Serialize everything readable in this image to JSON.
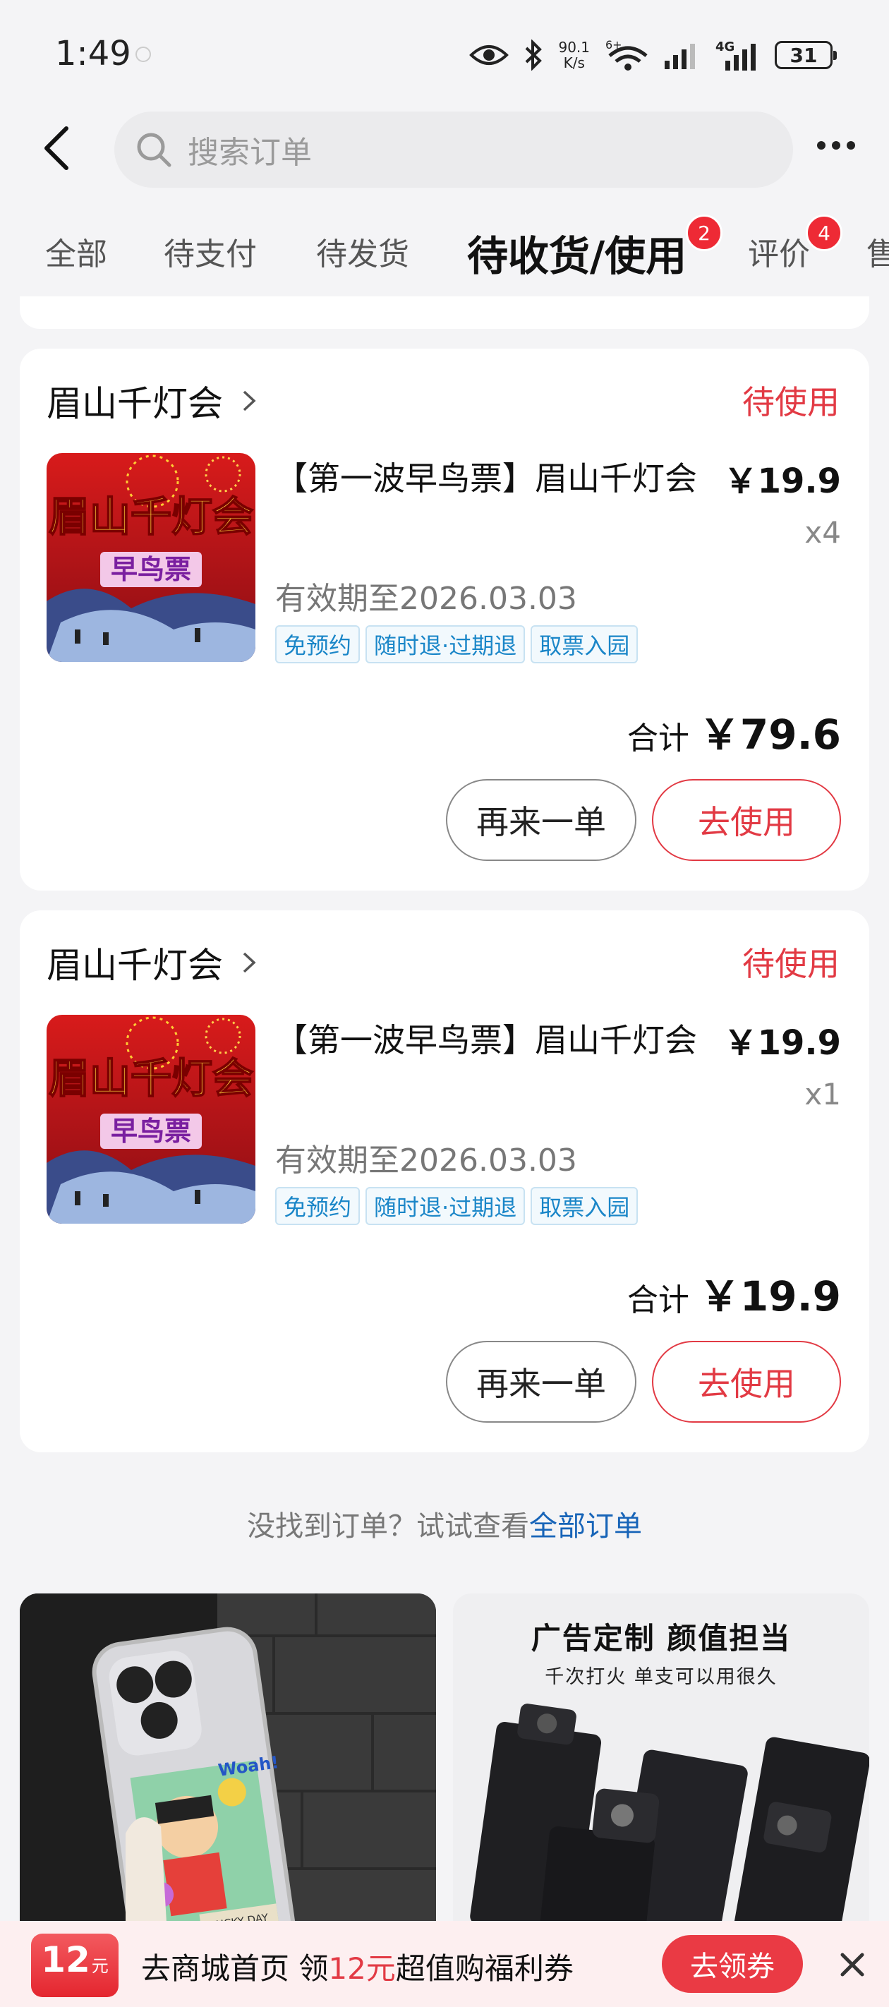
{
  "status_bar": {
    "time": "1:49",
    "net_speed_value": "90.1",
    "net_speed_unit": "K/s",
    "wifi_label": "6+",
    "cell_label": "4G",
    "battery": "31"
  },
  "search": {
    "placeholder": "搜索订单"
  },
  "tabs": [
    {
      "label": "全部"
    },
    {
      "label": "待支付"
    },
    {
      "label": "待发货"
    },
    {
      "label": "待收货/使用",
      "active": true,
      "badge": "2"
    },
    {
      "label": "评价",
      "badge": "4"
    },
    {
      "label": "售"
    }
  ],
  "orders": [
    {
      "shop": "眉山千灯会",
      "status": "待使用",
      "thumb_text_top": "眉山千灯会",
      "thumb_text_bottom": "早鸟票",
      "title": "【第一波早鸟票】眉山千灯会",
      "price": "￥19.9",
      "qty": "x4",
      "validity": "有效期至2026.03.03",
      "tags": [
        "免预约",
        "随时退·过期退",
        "取票入园"
      ],
      "total_label": "合计",
      "total": "￥79.6",
      "reorder": "再来一单",
      "use": "去使用"
    },
    {
      "shop": "眉山千灯会",
      "status": "待使用",
      "thumb_text_top": "眉山千灯会",
      "thumb_text_bottom": "早鸟票",
      "title": "【第一波早鸟票】眉山千灯会",
      "price": "￥19.9",
      "qty": "x1",
      "validity": "有效期至2026.03.03",
      "tags": [
        "免预约",
        "随时退·过期退",
        "取票入园"
      ],
      "total_label": "合计",
      "total": "￥19.9",
      "reorder": "再来一单",
      "use": "去使用"
    }
  ],
  "hint": {
    "text": "没找到订单？试试查看",
    "link": "全部订单"
  },
  "recommendations": {
    "left_case_text_1": "LUCKY DAY",
    "left_case_text_2": "Woah!",
    "right_ad_title": "广告定制  颜值担当",
    "right_ad_sub": "千次打火  单支可以用很久"
  },
  "promo": {
    "coupon_amount": "12",
    "coupon_unit": "元",
    "text_before": "去商城首页 领",
    "text_highlight": "12元",
    "text_after": "超值购福利券",
    "button": "去领券"
  },
  "colors": {
    "accent": "#e23a44",
    "link": "#1764b8",
    "tag": "#1a86c8",
    "background": "#f4f4f6"
  }
}
